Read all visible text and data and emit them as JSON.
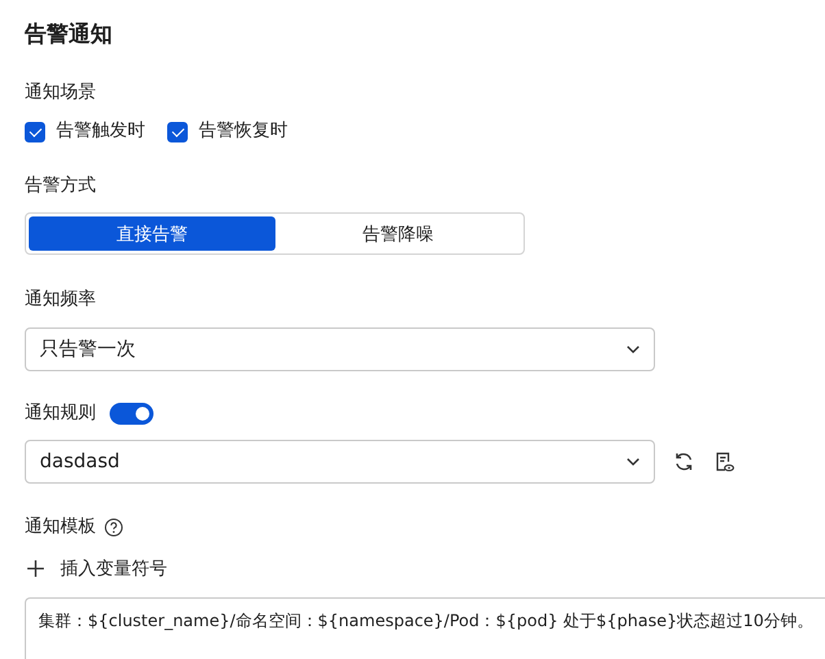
{
  "title": "告警通知",
  "scenario": {
    "label": "通知场景",
    "options": [
      {
        "label": "告警触发时",
        "checked": true
      },
      {
        "label": "告警恢复时",
        "checked": true
      }
    ]
  },
  "mode": {
    "label": "告警方式",
    "options": [
      {
        "label": "直接告警",
        "selected": true
      },
      {
        "label": "告警降噪",
        "selected": false
      }
    ]
  },
  "frequency": {
    "label": "通知频率",
    "value": "只告警一次"
  },
  "rule": {
    "label": "通知规则",
    "on": true,
    "value": "dasdasd"
  },
  "template": {
    "label": "通知模板",
    "insert": "插入变量符号",
    "value": "集群：${cluster_name}/命名空间：${namespace}/Pod：${pod} 处于${phase}状态超过10分钟。"
  }
}
